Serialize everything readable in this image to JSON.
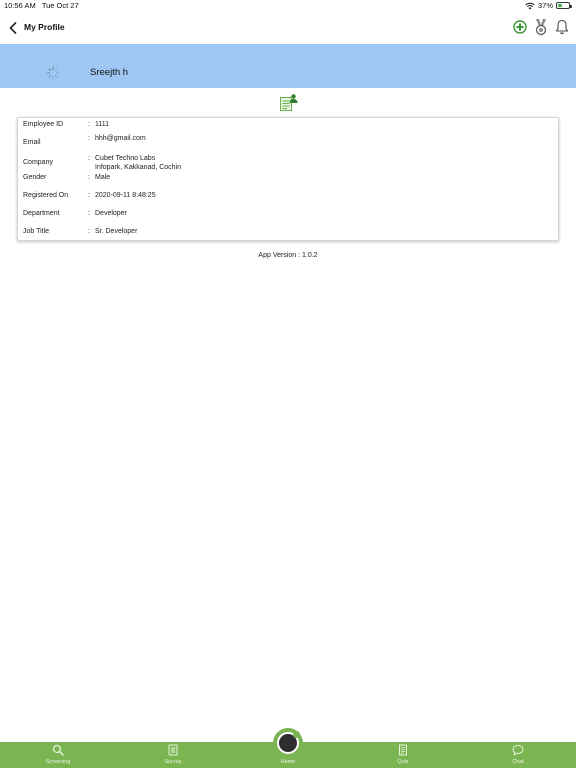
{
  "status_bar": {
    "time": "10:56 AM",
    "date": "Tue Oct 27",
    "battery_percent": "37%",
    "battery_level": 0.37,
    "wifi_icon": "wifi-icon"
  },
  "header": {
    "title": "My Profile",
    "back_icon": "chevron-left-icon",
    "actions": [
      "add-circle-icon",
      "medal-icon",
      "bell-icon"
    ],
    "accent_color": "#3a9a3a"
  },
  "profile": {
    "name": "Sreejth h",
    "banner_color": "#9fc7f4"
  },
  "details": {
    "rows": [
      {
        "label": "Employee ID",
        "value": "1111"
      },
      {
        "label": "Email",
        "value": "hhh@gmail.com"
      },
      {
        "label": "Company",
        "value": "Cubet Techno Labs\nInfopark, Kakkanad, Cochin"
      },
      {
        "label": "Gender",
        "value": "Male"
      },
      {
        "label": "Registered On",
        "value": "2020-09-11 8:48:25"
      },
      {
        "label": "Department",
        "value": "Developer"
      },
      {
        "label": "Job Title",
        "value": "Sr. Developer"
      }
    ],
    "separator": ":"
  },
  "app_version": "App Version : 1.0.2",
  "tab_bar": {
    "color": "#7ab552",
    "tabs": [
      {
        "label": "Screening",
        "icon": "search-icon"
      },
      {
        "label": "Survey",
        "icon": "survey-icon"
      },
      {
        "label": "Home",
        "icon": "home-icon"
      },
      {
        "label": "Quiz",
        "icon": "quiz-icon"
      },
      {
        "label": "Chat",
        "icon": "chat-icon"
      }
    ]
  }
}
